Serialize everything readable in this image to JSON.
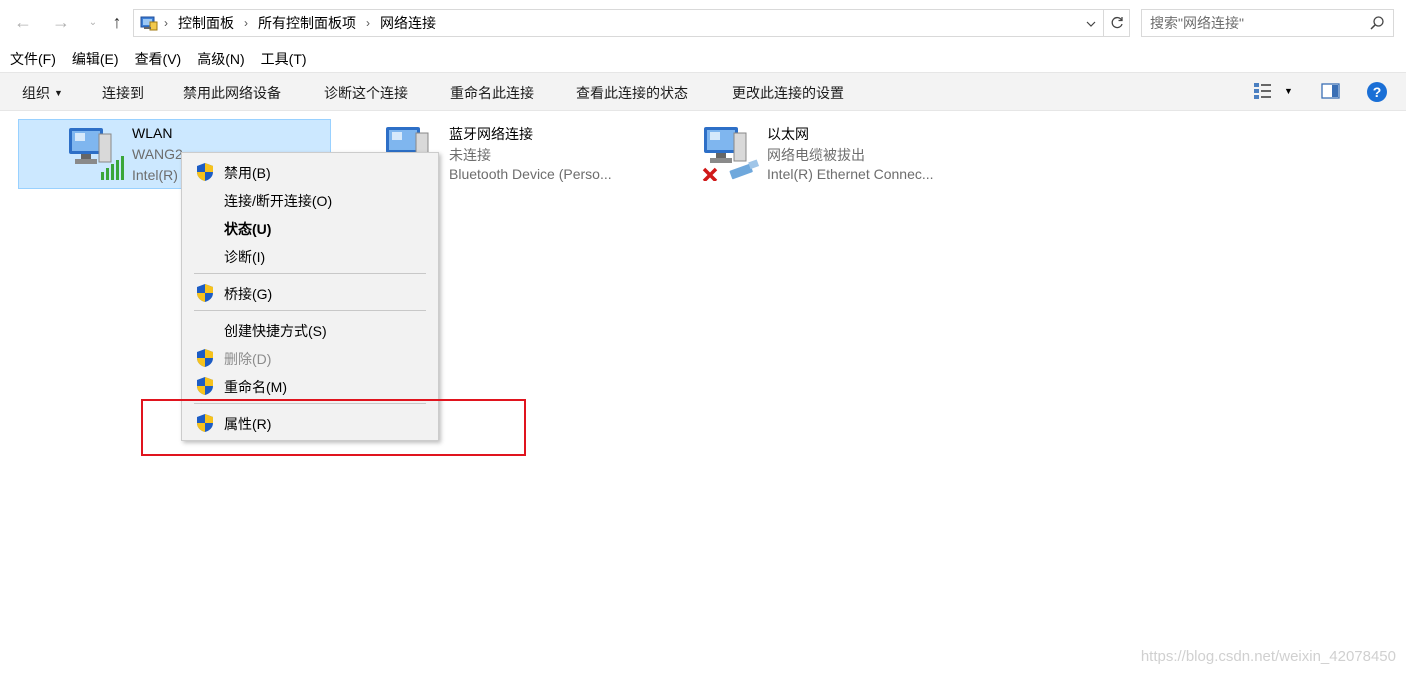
{
  "breadcrumb": [
    "控制面板",
    "所有控制面板项",
    "网络连接"
  ],
  "search": {
    "placeholder": "搜索\"网络连接\""
  },
  "menubar": [
    "文件(F)",
    "编辑(E)",
    "查看(V)",
    "高级(N)",
    "工具(T)"
  ],
  "toolbar": {
    "organize": "组织",
    "connect_to": "连接到",
    "disable_device": "禁用此网络设备",
    "diagnose": "诊断这个连接",
    "rename": "重命名此连接",
    "view_status": "查看此连接的状态",
    "change_settings": "更改此连接的设置"
  },
  "connections": [
    {
      "name": "WLAN",
      "status": "WANG2",
      "device": "Intel(R)",
      "icon": "wifi-computer-icon",
      "selected": true
    },
    {
      "name": "蓝牙网络连接",
      "status": "未连接",
      "device": "Bluetooth Device (Perso...",
      "icon": "bluetooth-computer-icon"
    },
    {
      "name": "以太网",
      "status": "网络电缆被拔出",
      "device": "Intel(R) Ethernet Connec...",
      "icon": "ethernet-computer-icon"
    }
  ],
  "context_menu": {
    "disable": "禁用(B)",
    "connect_disconnect": "连接/断开连接(O)",
    "status": "状态(U)",
    "diagnose": "诊断(I)",
    "bridge": "桥接(G)",
    "create_shortcut": "创建快捷方式(S)",
    "delete": "删除(D)",
    "rename": "重命名(M)",
    "properties": "属性(R)"
  },
  "watermark": "https://blog.csdn.net/weixin_42078450",
  "colors": {
    "selection": "#cce8ff",
    "highlight_border": "#e0141e",
    "help": "#1a6fd6"
  }
}
